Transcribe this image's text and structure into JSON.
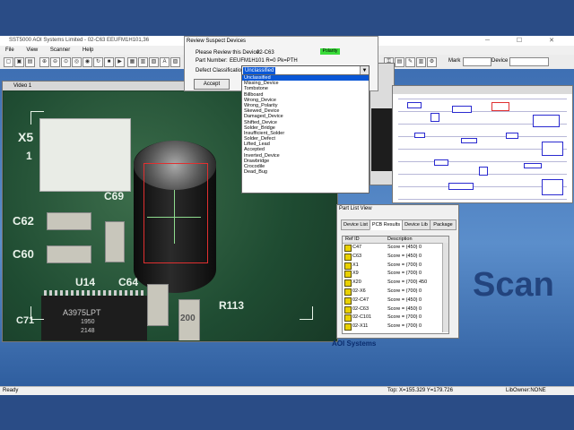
{
  "app": {
    "title": "SST5000 AOI Systems Limited - 02-C63 EEUFM1H101,36",
    "menu": [
      "File",
      "View",
      "Scanner",
      "Help"
    ]
  },
  "toolbar": {
    "mark_label": "Mark",
    "device_label": "Device"
  },
  "video_window": {
    "title": "Video 1",
    "board_labels": [
      "X5",
      "1",
      "C62",
      "C60",
      "C69",
      "U14",
      "C64",
      "R113",
      "C71",
      "200",
      "A3975LPT",
      "1950",
      "2148"
    ]
  },
  "review_dialog": {
    "title": "Review Suspect Devices",
    "review_label": "Please Review this Device:",
    "review_value": "02-C63",
    "status_badge": "Polarity",
    "part_number_label": "Part Number:",
    "part_number_value": "EEUFM1H101 R=0 Pk=PTH",
    "defect_label": "Defect Classification:",
    "selected_classification": "Unclassified",
    "accept_button": "Accept",
    "options": [
      "Unclassified",
      "Missing_Device",
      "Tombstone",
      "Billboard",
      "Wrong_Device",
      "Wrong_Polarity",
      "Skewed_Device",
      "Damaged_Device",
      "Shifted_Device",
      "Solder_Bridge",
      "Insufficient_Solder",
      "Solder_Defect",
      "Lifted_Lead",
      "Accepted",
      "Inverted_Device",
      "Drawbridge",
      "Crocodile",
      "Dead_Bug"
    ]
  },
  "part_list": {
    "title": "Part List View",
    "tabs": [
      "Device List",
      "PCB Results",
      "Device Lib",
      "Package"
    ],
    "active_tab": "PCB Results",
    "columns": [
      "Ref ID",
      "Description"
    ],
    "rows": [
      {
        "ref": "C47",
        "desc": "Score = (450) 0"
      },
      {
        "ref": "C63",
        "desc": "Score = (450) 0"
      },
      {
        "ref": "X1",
        "desc": "Score = (700) 0"
      },
      {
        "ref": "X9",
        "desc": "Score = (700) 0"
      },
      {
        "ref": "X20",
        "desc": "Score = (700) 450"
      },
      {
        "ref": "02-X6",
        "desc": "Score = (700) 0"
      },
      {
        "ref": "02-C47",
        "desc": "Score = (450) 0"
      },
      {
        "ref": "02-C63",
        "desc": "Score = (450) 0"
      },
      {
        "ref": "02-C101",
        "desc": "Score = (700) 0"
      },
      {
        "ref": "02-X11",
        "desc": "Score = (700) 0"
      }
    ]
  },
  "branding": {
    "aoi_label": "AOI Systems",
    "large_text": "Scan"
  },
  "status_bar": {
    "left": "Ready",
    "coords": "Top: X=155.329 Y=179.726",
    "lib": "LibOwner:NONE"
  }
}
